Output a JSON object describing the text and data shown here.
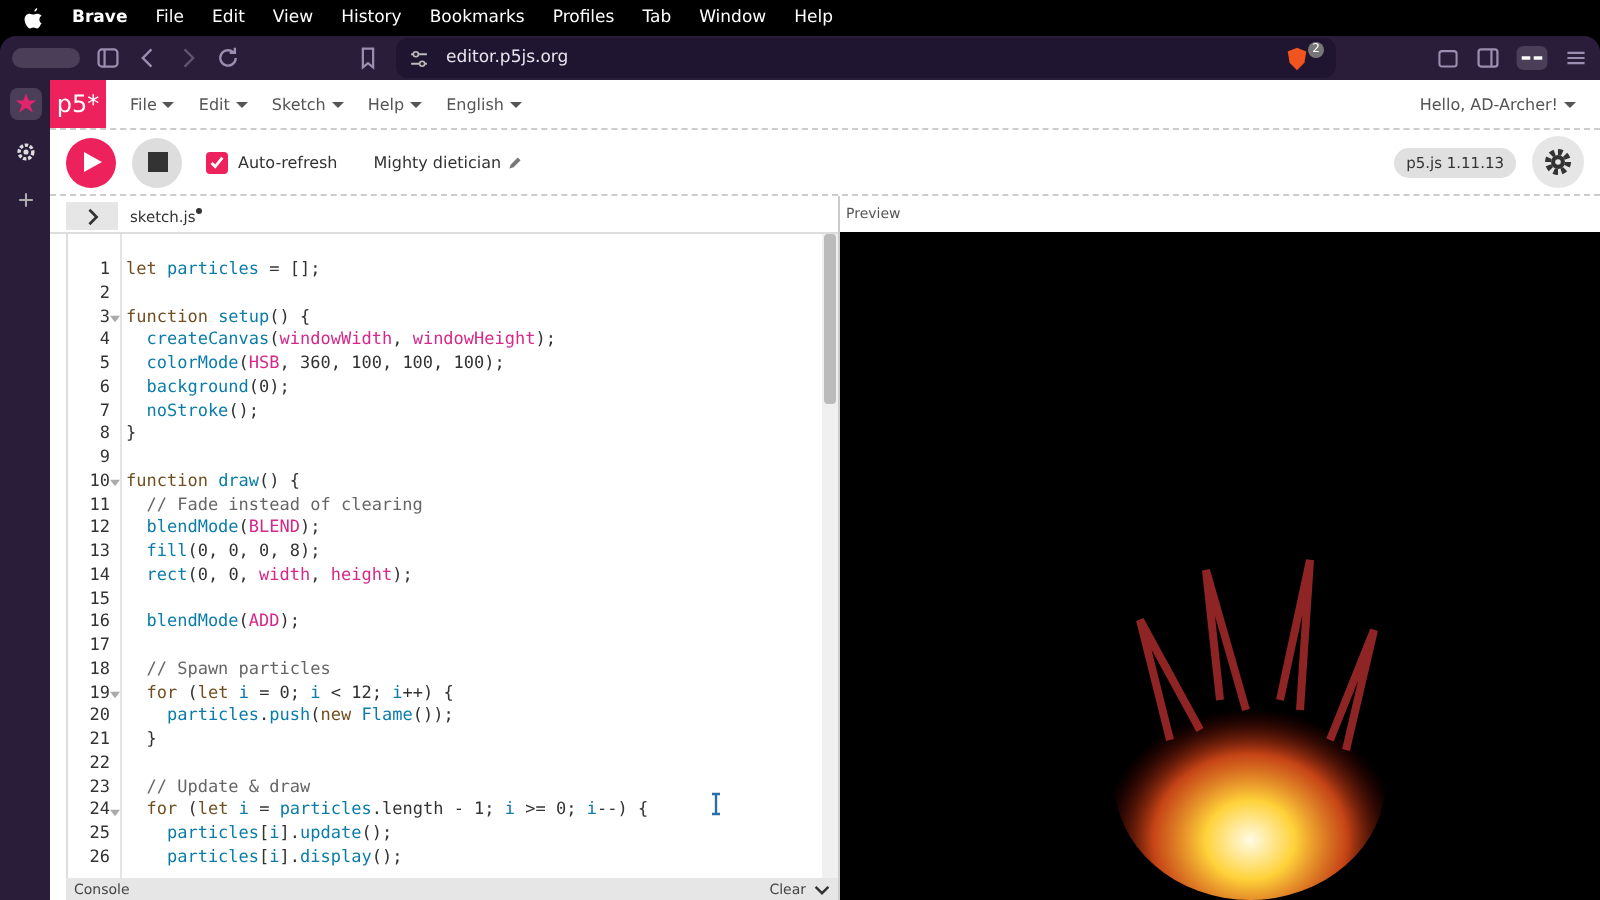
{
  "mac_menu": [
    "Brave",
    "File",
    "Edit",
    "View",
    "History",
    "Bookmarks",
    "Profiles",
    "Tab",
    "Window",
    "Help"
  ],
  "browser": {
    "url": "editor.p5js.org",
    "shields_count": "2"
  },
  "app_nav": {
    "logo": "p5*",
    "menus": [
      "File",
      "Edit",
      "Sketch",
      "Help",
      "English"
    ],
    "user": "Hello, AD-Archer!"
  },
  "toolbar": {
    "auto_refresh": {
      "label": "Auto-refresh",
      "checked": true
    },
    "sketch_name": "Mighty dietician",
    "version": "p5.js 1.11.13"
  },
  "editor": {
    "file_tab": "sketch.js",
    "unsaved": true,
    "lines": [
      {
        "n": "1",
        "fold": false,
        "segs": [
          {
            "kind": "keyword",
            "text": "let "
          },
          {
            "kind": "name",
            "text": "particles"
          },
          {
            "kind": "plain",
            "text": " = [];"
          }
        ]
      },
      {
        "n": "2",
        "fold": false
      },
      {
        "n": "3",
        "fold": true,
        "segs": [
          {
            "kind": "keyword",
            "text": "function "
          },
          {
            "kind": "name",
            "text": "setup"
          },
          {
            "kind": "plain",
            "text": "() {"
          }
        ]
      },
      {
        "n": "4",
        "fold": false,
        "segs": [
          {
            "kind": "name",
            "text": "  createCanvas"
          },
          {
            "kind": "plain",
            "text": "("
          },
          {
            "kind": "builtin",
            "text": "windowWidth"
          },
          {
            "kind": "plain",
            "text": ", "
          },
          {
            "kind": "builtin",
            "text": "windowHeight"
          },
          {
            "kind": "plain",
            "text": ");"
          }
        ]
      },
      {
        "n": "5",
        "fold": false,
        "segs": [
          {
            "kind": "name",
            "text": "  colorMode"
          },
          {
            "kind": "plain",
            "text": "("
          },
          {
            "kind": "builtin",
            "text": "HSB"
          },
          {
            "kind": "plain",
            "text": ", 360, 100, 100, 100);"
          }
        ]
      },
      {
        "n": "6",
        "fold": false,
        "segs": [
          {
            "kind": "name",
            "text": "  background"
          },
          {
            "kind": "plain",
            "text": "(0);"
          }
        ]
      },
      {
        "n": "7",
        "fold": false,
        "segs": [
          {
            "kind": "name",
            "text": "  noStroke"
          },
          {
            "kind": "plain",
            "text": "();"
          }
        ]
      },
      {
        "n": "8",
        "fold": false,
        "segs": [
          {
            "kind": "plain",
            "text": "}"
          }
        ]
      },
      {
        "n": "9",
        "fold": false
      },
      {
        "n": "10",
        "fold": true,
        "segs": [
          {
            "kind": "keyword",
            "text": "function "
          },
          {
            "kind": "name",
            "text": "draw"
          },
          {
            "kind": "plain",
            "text": "() {"
          }
        ]
      },
      {
        "n": "11",
        "fold": false,
        "segs": [
          {
            "kind": "comment",
            "text": "  // Fade instead of clearing"
          }
        ]
      },
      {
        "n": "12",
        "fold": false,
        "segs": [
          {
            "kind": "name",
            "text": "  blendMode"
          },
          {
            "kind": "plain",
            "text": "("
          },
          {
            "kind": "builtin",
            "text": "BLEND"
          },
          {
            "kind": "plain",
            "text": ");"
          }
        ]
      },
      {
        "n": "13",
        "fold": false,
        "segs": [
          {
            "kind": "name",
            "text": "  fill"
          },
          {
            "kind": "plain",
            "text": "(0, 0, 0, 8);"
          }
        ]
      },
      {
        "n": "14",
        "fold": false,
        "segs": [
          {
            "kind": "name",
            "text": "  rect"
          },
          {
            "kind": "plain",
            "text": "(0, 0, "
          },
          {
            "kind": "builtin",
            "text": "width"
          },
          {
            "kind": "plain",
            "text": ", "
          },
          {
            "kind": "builtin",
            "text": "height"
          },
          {
            "kind": "plain",
            "text": ");"
          }
        ]
      },
      {
        "n": "15",
        "fold": false
      },
      {
        "n": "16",
        "fold": false,
        "segs": [
          {
            "kind": "name",
            "text": "  blendMode"
          },
          {
            "kind": "plain",
            "text": "("
          },
          {
            "kind": "builtin",
            "text": "ADD"
          },
          {
            "kind": "plain",
            "text": ");"
          }
        ]
      },
      {
        "n": "17",
        "fold": false
      },
      {
        "n": "18",
        "fold": false,
        "segs": [
          {
            "kind": "comment",
            "text": "  // Spawn particles"
          }
        ]
      },
      {
        "n": "19",
        "fold": true,
        "segs": [
          {
            "kind": "keyword",
            "text": "  for "
          },
          {
            "kind": "plain",
            "text": "("
          },
          {
            "kind": "keyword",
            "text": "let "
          },
          {
            "kind": "name",
            "text": "i"
          },
          {
            "kind": "plain",
            "text": " = 0; "
          },
          {
            "kind": "name",
            "text": "i"
          },
          {
            "kind": "plain",
            "text": " < 12; "
          },
          {
            "kind": "name",
            "text": "i"
          },
          {
            "kind": "plain",
            "text": "++) {"
          }
        ]
      },
      {
        "n": "20",
        "fold": false,
        "segs": [
          {
            "kind": "name",
            "text": "    particles"
          },
          {
            "kind": "plain",
            "text": "."
          },
          {
            "kind": "name",
            "text": "push"
          },
          {
            "kind": "plain",
            "text": "("
          },
          {
            "kind": "keyword",
            "text": "new "
          },
          {
            "kind": "name",
            "text": "Flame"
          },
          {
            "kind": "plain",
            "text": "());"
          }
        ]
      },
      {
        "n": "21",
        "fold": false,
        "segs": [
          {
            "kind": "plain",
            "text": "  }"
          }
        ]
      },
      {
        "n": "22",
        "fold": false
      },
      {
        "n": "23",
        "fold": false,
        "segs": [
          {
            "kind": "comment",
            "text": "  // Update & draw"
          }
        ]
      },
      {
        "n": "24",
        "fold": true,
        "segs": [
          {
            "kind": "keyword",
            "text": "  for "
          },
          {
            "kind": "plain",
            "text": "("
          },
          {
            "kind": "keyword",
            "text": "let "
          },
          {
            "kind": "name",
            "text": "i"
          },
          {
            "kind": "plain",
            "text": " = "
          },
          {
            "kind": "name",
            "text": "particles"
          },
          {
            "kind": "plain",
            "text": ".length - 1; "
          },
          {
            "kind": "name",
            "text": "i"
          },
          {
            "kind": "plain",
            "text": " >= 0; "
          },
          {
            "kind": "name",
            "text": "i"
          },
          {
            "kind": "plain",
            "text": "--) {"
          }
        ]
      },
      {
        "n": "25",
        "fold": false,
        "segs": [
          {
            "kind": "name",
            "text": "    particles"
          },
          {
            "kind": "plain",
            "text": "["
          },
          {
            "kind": "name",
            "text": "i"
          },
          {
            "kind": "plain",
            "text": "]."
          },
          {
            "kind": "name",
            "text": "update"
          },
          {
            "kind": "plain",
            "text": "();"
          }
        ]
      },
      {
        "n": "26",
        "fold": false,
        "segs": [
          {
            "kind": "name",
            "text": "    particles"
          },
          {
            "kind": "plain",
            "text": "["
          },
          {
            "kind": "name",
            "text": "i"
          },
          {
            "kind": "plain",
            "text": "]."
          },
          {
            "kind": "name",
            "text": "display"
          },
          {
            "kind": "plain",
            "text": "();"
          }
        ]
      }
    ]
  },
  "console": {
    "title": "Console",
    "clear": "Clear"
  },
  "preview": {
    "title": "Preview"
  }
}
